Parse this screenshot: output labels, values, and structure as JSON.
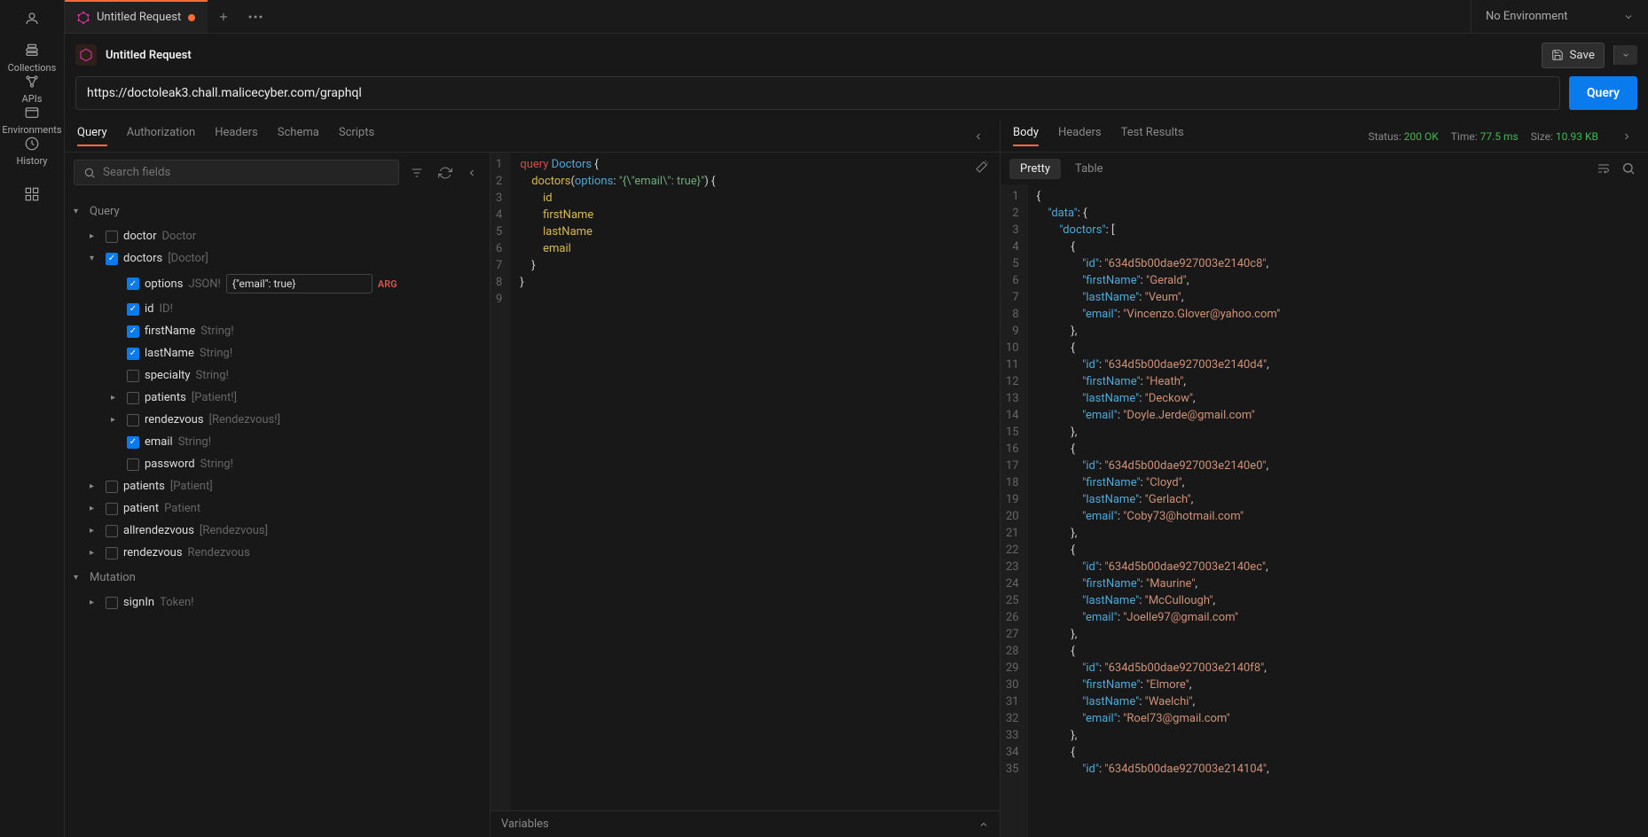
{
  "rail": {
    "items": [
      {
        "label": "Collections",
        "icon": "collections"
      },
      {
        "label": "APIs",
        "icon": "apis"
      },
      {
        "label": "Environments",
        "icon": "environments"
      },
      {
        "label": "History",
        "icon": "history"
      }
    ]
  },
  "tabs": {
    "active": {
      "title": "Untitled Request",
      "modified": true
    }
  },
  "env": {
    "selected": "No Environment"
  },
  "header": {
    "title": "Untitled Request",
    "save": "Save"
  },
  "url": {
    "value": "https://doctoleak3.chall.malicecyber.com/graphql",
    "send": "Query"
  },
  "reqTabs": [
    "Query",
    "Authorization",
    "Headers",
    "Schema",
    "Scripts"
  ],
  "reqTabActive": "Query",
  "explorer": {
    "searchPlaceholder": "Search fields",
    "sections": {
      "query": "Query",
      "mutation": "Mutation"
    },
    "queryFields": [
      {
        "name": "doctor",
        "type": "Doctor",
        "checked": false,
        "caret": true,
        "depth": 0
      },
      {
        "name": "doctors",
        "type": "[Doctor]",
        "checked": true,
        "caret": true,
        "open": true,
        "depth": 0
      },
      {
        "name": "options",
        "type": "JSON!",
        "checked": true,
        "depth": 1,
        "arg": true,
        "argValue": "{\"email\": true}",
        "argBadge": "ARG"
      },
      {
        "name": "id",
        "type": "ID!",
        "checked": true,
        "depth": 1
      },
      {
        "name": "firstName",
        "type": "String!",
        "checked": true,
        "depth": 1
      },
      {
        "name": "lastName",
        "type": "String!",
        "checked": true,
        "depth": 1
      },
      {
        "name": "specialty",
        "type": "String!",
        "checked": false,
        "depth": 1
      },
      {
        "name": "patients",
        "type": "[Patient!]",
        "checked": false,
        "caret": true,
        "depth": 1
      },
      {
        "name": "rendezvous",
        "type": "[Rendezvous!]",
        "checked": false,
        "caret": true,
        "depth": 1
      },
      {
        "name": "email",
        "type": "String!",
        "checked": true,
        "depth": 1
      },
      {
        "name": "password",
        "type": "String!",
        "checked": false,
        "depth": 1
      },
      {
        "name": "patients",
        "type": "[Patient]",
        "checked": false,
        "caret": true,
        "depth": 0
      },
      {
        "name": "patient",
        "type": "Patient",
        "checked": false,
        "caret": true,
        "depth": 0
      },
      {
        "name": "allrendezvous",
        "type": "[Rendezvous]",
        "checked": false,
        "caret": true,
        "depth": 0
      },
      {
        "name": "rendezvous",
        "type": "Rendezvous",
        "checked": false,
        "caret": true,
        "depth": 0
      }
    ],
    "mutationFields": [
      {
        "name": "signIn",
        "type": "Token!",
        "checked": false,
        "caret": true,
        "depth": 0
      }
    ]
  },
  "queryCode": [
    {
      "n": 1,
      "tokens": [
        [
          "kw-query",
          "query "
        ],
        [
          "kw-name",
          "Doctors"
        ],
        [
          "kw-punc",
          " {"
        ]
      ]
    },
    {
      "n": 2,
      "tokens": [
        [
          "",
          "    "
        ],
        [
          "kw-field",
          "doctors"
        ],
        [
          "kw-punc",
          "("
        ],
        [
          "kw-arg",
          "options"
        ],
        [
          "kw-punc",
          ": "
        ],
        [
          "kw-str",
          "\"{\\\"email\\\": true}\""
        ],
        [
          "kw-punc",
          ") {"
        ]
      ]
    },
    {
      "n": 3,
      "tokens": [
        [
          "",
          "        "
        ],
        [
          "kw-field",
          "id"
        ]
      ]
    },
    {
      "n": 4,
      "tokens": [
        [
          "",
          "        "
        ],
        [
          "kw-field",
          "firstName"
        ]
      ]
    },
    {
      "n": 5,
      "tokens": [
        [
          "",
          "        "
        ],
        [
          "kw-field",
          "lastName"
        ]
      ]
    },
    {
      "n": 6,
      "tokens": [
        [
          "",
          "        "
        ],
        [
          "kw-field",
          "email"
        ]
      ]
    },
    {
      "n": 7,
      "tokens": [
        [
          "",
          "    "
        ],
        [
          "kw-punc",
          "}"
        ]
      ]
    },
    {
      "n": 8,
      "tokens": [
        [
          "kw-punc",
          "}"
        ]
      ]
    },
    {
      "n": 9,
      "tokens": [
        [
          "",
          ""
        ]
      ]
    }
  ],
  "variablesLabel": "Variables",
  "resTabs": [
    "Body",
    "Headers",
    "Test Results"
  ],
  "resTabActive": "Body",
  "status": {
    "label": "Status:",
    "code": "200 OK",
    "timeLabel": "Time:",
    "time": "77.5 ms",
    "sizeLabel": "Size:",
    "size": "10.93 KB"
  },
  "resViewTabs": [
    "Pretty",
    "Table"
  ],
  "resViewActive": "Pretty",
  "responseCode": [
    {
      "n": 1,
      "tokens": [
        [
          "kw-punc",
          "{"
        ]
      ]
    },
    {
      "n": 2,
      "tokens": [
        [
          "",
          "    "
        ],
        [
          "kw-key",
          "\"data\""
        ],
        [
          "kw-punc",
          ": {"
        ]
      ]
    },
    {
      "n": 3,
      "tokens": [
        [
          "",
          "        "
        ],
        [
          "kw-key",
          "\"doctors\""
        ],
        [
          "kw-punc",
          ": ["
        ]
      ]
    },
    {
      "n": 4,
      "tokens": [
        [
          "",
          "            "
        ],
        [
          "kw-punc",
          "{"
        ]
      ]
    },
    {
      "n": 5,
      "tokens": [
        [
          "",
          "                "
        ],
        [
          "kw-key",
          "\"id\""
        ],
        [
          "kw-punc",
          ": "
        ],
        [
          "kw-val-str",
          "\"634d5b00dae927003e2140c8\""
        ],
        [
          "kw-punc",
          ","
        ]
      ]
    },
    {
      "n": 6,
      "tokens": [
        [
          "",
          "                "
        ],
        [
          "kw-key",
          "\"firstName\""
        ],
        [
          "kw-punc",
          ": "
        ],
        [
          "kw-val-str",
          "\"Gerald\""
        ],
        [
          "kw-punc",
          ","
        ]
      ]
    },
    {
      "n": 7,
      "tokens": [
        [
          "",
          "                "
        ],
        [
          "kw-key",
          "\"lastName\""
        ],
        [
          "kw-punc",
          ": "
        ],
        [
          "kw-val-str",
          "\"Veum\""
        ],
        [
          "kw-punc",
          ","
        ]
      ]
    },
    {
      "n": 8,
      "tokens": [
        [
          "",
          "                "
        ],
        [
          "kw-key",
          "\"email\""
        ],
        [
          "kw-punc",
          ": "
        ],
        [
          "kw-val-str",
          "\"Vincenzo.Glover@yahoo.com\""
        ]
      ]
    },
    {
      "n": 9,
      "tokens": [
        [
          "",
          "            "
        ],
        [
          "kw-punc",
          "},"
        ]
      ]
    },
    {
      "n": 10,
      "tokens": [
        [
          "",
          "            "
        ],
        [
          "kw-punc",
          "{"
        ]
      ]
    },
    {
      "n": 11,
      "tokens": [
        [
          "",
          "                "
        ],
        [
          "kw-key",
          "\"id\""
        ],
        [
          "kw-punc",
          ": "
        ],
        [
          "kw-val-str",
          "\"634d5b00dae927003e2140d4\""
        ],
        [
          "kw-punc",
          ","
        ]
      ]
    },
    {
      "n": 12,
      "tokens": [
        [
          "",
          "                "
        ],
        [
          "kw-key",
          "\"firstName\""
        ],
        [
          "kw-punc",
          ": "
        ],
        [
          "kw-val-str",
          "\"Heath\""
        ],
        [
          "kw-punc",
          ","
        ]
      ]
    },
    {
      "n": 13,
      "tokens": [
        [
          "",
          "                "
        ],
        [
          "kw-key",
          "\"lastName\""
        ],
        [
          "kw-punc",
          ": "
        ],
        [
          "kw-val-str",
          "\"Deckow\""
        ],
        [
          "kw-punc",
          ","
        ]
      ]
    },
    {
      "n": 14,
      "tokens": [
        [
          "",
          "                "
        ],
        [
          "kw-key",
          "\"email\""
        ],
        [
          "kw-punc",
          ": "
        ],
        [
          "kw-val-str",
          "\"Doyle.Jerde@gmail.com\""
        ]
      ]
    },
    {
      "n": 15,
      "tokens": [
        [
          "",
          "            "
        ],
        [
          "kw-punc",
          "},"
        ]
      ]
    },
    {
      "n": 16,
      "tokens": [
        [
          "",
          "            "
        ],
        [
          "kw-punc",
          "{"
        ]
      ]
    },
    {
      "n": 17,
      "tokens": [
        [
          "",
          "                "
        ],
        [
          "kw-key",
          "\"id\""
        ],
        [
          "kw-punc",
          ": "
        ],
        [
          "kw-val-str",
          "\"634d5b00dae927003e2140e0\""
        ],
        [
          "kw-punc",
          ","
        ]
      ]
    },
    {
      "n": 18,
      "tokens": [
        [
          "",
          "                "
        ],
        [
          "kw-key",
          "\"firstName\""
        ],
        [
          "kw-punc",
          ": "
        ],
        [
          "kw-val-str",
          "\"Cloyd\""
        ],
        [
          "kw-punc",
          ","
        ]
      ]
    },
    {
      "n": 19,
      "tokens": [
        [
          "",
          "                "
        ],
        [
          "kw-key",
          "\"lastName\""
        ],
        [
          "kw-punc",
          ": "
        ],
        [
          "kw-val-str",
          "\"Gerlach\""
        ],
        [
          "kw-punc",
          ","
        ]
      ]
    },
    {
      "n": 20,
      "tokens": [
        [
          "",
          "                "
        ],
        [
          "kw-key",
          "\"email\""
        ],
        [
          "kw-punc",
          ": "
        ],
        [
          "kw-val-str",
          "\"Coby73@hotmail.com\""
        ]
      ]
    },
    {
      "n": 21,
      "tokens": [
        [
          "",
          "            "
        ],
        [
          "kw-punc",
          "},"
        ]
      ]
    },
    {
      "n": 22,
      "tokens": [
        [
          "",
          "            "
        ],
        [
          "kw-punc",
          "{"
        ]
      ]
    },
    {
      "n": 23,
      "tokens": [
        [
          "",
          "                "
        ],
        [
          "kw-key",
          "\"id\""
        ],
        [
          "kw-punc",
          ": "
        ],
        [
          "kw-val-str",
          "\"634d5b00dae927003e2140ec\""
        ],
        [
          "kw-punc",
          ","
        ]
      ]
    },
    {
      "n": 24,
      "tokens": [
        [
          "",
          "                "
        ],
        [
          "kw-key",
          "\"firstName\""
        ],
        [
          "kw-punc",
          ": "
        ],
        [
          "kw-val-str",
          "\"Maurine\""
        ],
        [
          "kw-punc",
          ","
        ]
      ]
    },
    {
      "n": 25,
      "tokens": [
        [
          "",
          "                "
        ],
        [
          "kw-key",
          "\"lastName\""
        ],
        [
          "kw-punc",
          ": "
        ],
        [
          "kw-val-str",
          "\"McCullough\""
        ],
        [
          "kw-punc",
          ","
        ]
      ]
    },
    {
      "n": 26,
      "tokens": [
        [
          "",
          "                "
        ],
        [
          "kw-key",
          "\"email\""
        ],
        [
          "kw-punc",
          ": "
        ],
        [
          "kw-val-str",
          "\"Joelle97@gmail.com\""
        ]
      ]
    },
    {
      "n": 27,
      "tokens": [
        [
          "",
          "            "
        ],
        [
          "kw-punc",
          "},"
        ]
      ]
    },
    {
      "n": 28,
      "tokens": [
        [
          "",
          "            "
        ],
        [
          "kw-punc",
          "{"
        ]
      ]
    },
    {
      "n": 29,
      "tokens": [
        [
          "",
          "                "
        ],
        [
          "kw-key",
          "\"id\""
        ],
        [
          "kw-punc",
          ": "
        ],
        [
          "kw-val-str",
          "\"634d5b00dae927003e2140f8\""
        ],
        [
          "kw-punc",
          ","
        ]
      ]
    },
    {
      "n": 30,
      "tokens": [
        [
          "",
          "                "
        ],
        [
          "kw-key",
          "\"firstName\""
        ],
        [
          "kw-punc",
          ": "
        ],
        [
          "kw-val-str",
          "\"Elmore\""
        ],
        [
          "kw-punc",
          ","
        ]
      ]
    },
    {
      "n": 31,
      "tokens": [
        [
          "",
          "                "
        ],
        [
          "kw-key",
          "\"lastName\""
        ],
        [
          "kw-punc",
          ": "
        ],
        [
          "kw-val-str",
          "\"Waelchi\""
        ],
        [
          "kw-punc",
          ","
        ]
      ]
    },
    {
      "n": 32,
      "tokens": [
        [
          "",
          "                "
        ],
        [
          "kw-key",
          "\"email\""
        ],
        [
          "kw-punc",
          ": "
        ],
        [
          "kw-val-str",
          "\"Roel73@gmail.com\""
        ]
      ]
    },
    {
      "n": 33,
      "tokens": [
        [
          "",
          "            "
        ],
        [
          "kw-punc",
          "},"
        ]
      ]
    },
    {
      "n": 34,
      "tokens": [
        [
          "",
          "            "
        ],
        [
          "kw-punc",
          "{"
        ]
      ]
    },
    {
      "n": 35,
      "tokens": [
        [
          "",
          "                "
        ],
        [
          "kw-key",
          "\"id\""
        ],
        [
          "kw-punc",
          ": "
        ],
        [
          "kw-val-str",
          "\"634d5b00dae927003e214104\""
        ],
        [
          "kw-punc",
          ","
        ]
      ]
    }
  ]
}
